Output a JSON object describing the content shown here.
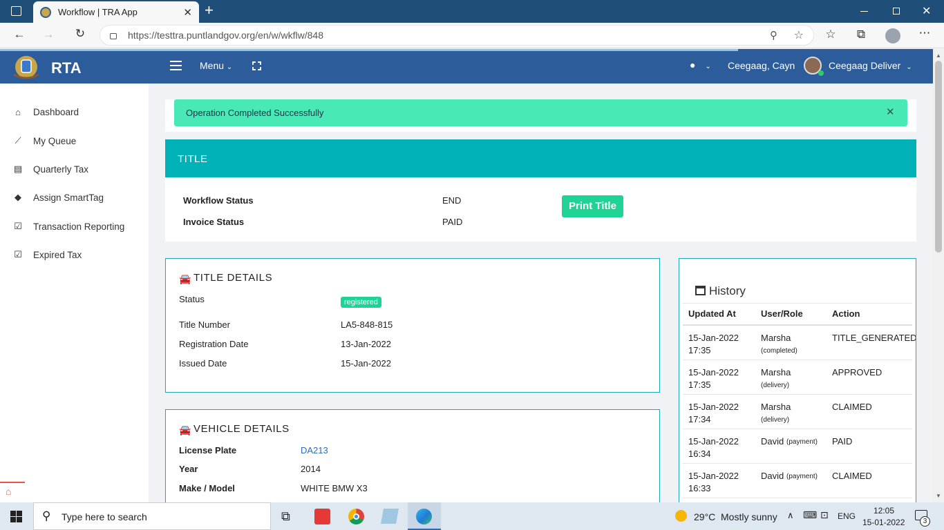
{
  "browser": {
    "tab_title": "Workflow | TRA App",
    "url": "https://testtra.puntlandgov.org/en/w/wkflw/848"
  },
  "header": {
    "brand": "RTA",
    "menu_label": "Menu",
    "user_short": "Ceegaag, Cayn",
    "user_full": "Ceegaag Deliver"
  },
  "sidebar": {
    "items": [
      {
        "label": "Dashboard",
        "icon": "home-icon"
      },
      {
        "label": "My Queue",
        "icon": "chart-line-icon"
      },
      {
        "label": "Quarterly Tax",
        "icon": "table-icon"
      },
      {
        "label": "Assign SmartTag",
        "icon": "tags-icon"
      },
      {
        "label": "Transaction Reporting",
        "icon": "check-square-icon"
      },
      {
        "label": "Expired Tax",
        "icon": "check-square-icon"
      }
    ]
  },
  "alert": {
    "message": "Operation Completed Successfully",
    "color": "#48e8b7"
  },
  "title_panel": {
    "heading": "TITLE",
    "workflow_status_label": "Workflow Status",
    "workflow_status_value": "END",
    "invoice_status_label": "Invoice Status",
    "invoice_status_value": "PAID",
    "print_button": "Print Title",
    "accent": "#00b2b8"
  },
  "title_details": {
    "heading": "TITLE DETAILS",
    "status_label": "Status",
    "status_badge": "registered",
    "title_number_label": "Title Number",
    "title_number": "LA5-848-815",
    "registration_date_label": "Registration Date",
    "registration_date": "13-Jan-2022",
    "issued_date_label": "Issued Date",
    "issued_date": "15-Jan-2022"
  },
  "vehicle_details": {
    "heading": "VEHICLE DETAILS",
    "license_plate_label": "License Plate",
    "license_plate": "DA213",
    "year_label": "Year",
    "year": "2014",
    "make_model_label": "Make / Model",
    "make_model": "WHITE BMW X3"
  },
  "history": {
    "heading": "History",
    "columns": [
      "Updated At",
      "User/Role",
      "Action"
    ],
    "rows": [
      {
        "date": "15-Jan-2022",
        "time": "17:35",
        "user": "Marsha",
        "role": "(completed)",
        "action": "TITLE_GENERATED"
      },
      {
        "date": "15-Jan-2022",
        "time": "17:35",
        "user": "Marsha",
        "role": "(delivery)",
        "action": "APPROVED"
      },
      {
        "date": "15-Jan-2022",
        "time": "17:34",
        "user": "Marsha",
        "role": "(delivery)",
        "action": "CLAIMED"
      },
      {
        "date": "15-Jan-2022",
        "time": "16:34",
        "user": "David",
        "role": "(payment)",
        "action": "PAID"
      },
      {
        "date": "15-Jan-2022",
        "time": "16:33",
        "user": "David",
        "role": "(payment)",
        "action": "CLAIMED"
      }
    ]
  },
  "taskbar": {
    "search_placeholder": "Type here to search",
    "weather_temp": "29°C",
    "weather_desc": "Mostly sunny",
    "lang": "ENG",
    "time": "12:05",
    "date": "15-01-2022",
    "notifications": "3"
  }
}
